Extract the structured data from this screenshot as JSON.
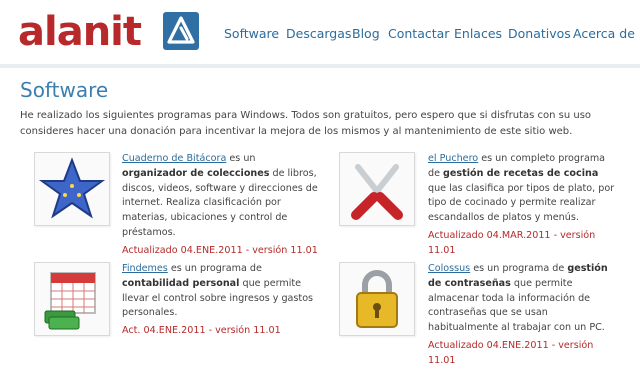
{
  "header": {
    "logo_text": "alanit",
    "nav": [
      "Software",
      "Descargas",
      "Blog",
      "Contactar",
      "Enlaces",
      "Donativos",
      "Acerca de"
    ]
  },
  "page": {
    "title": "Software",
    "intro": "He realizado los siguientes programas para Windows. Todos son gratuitos, pero espero que si disfrutas con su uso consideres hacer una donación para incentivar la mejora de los mismos y al mantenimiento de este sitio web."
  },
  "programs": [
    {
      "icon": "star-icon",
      "name": "Cuaderno de Bitácora",
      "pre": " es un ",
      "bold": "organizador de colecciones",
      "post": " de libros, discos, videos, software y direcciones de internet. Realiza clasificación por materias, ubicaciones y control de préstamos.",
      "updated": "Actualizado 04.ENE.2011 - versión 11.01"
    },
    {
      "icon": "fork-spoon-icon",
      "name": "el Puchero",
      "pre": " es un completo programa de ",
      "bold": "gestión de recetas de cocina",
      "post": " que las clasifica por tipos de plato, por tipo de cocinado y permite realizar escandallos de platos y menús.",
      "updated": "Actualizado 04.MAR.2011 - versión 11.01"
    },
    {
      "icon": "calendar-money-icon",
      "name": "Findemes",
      "pre": " es un programa de ",
      "bold": "contabilidad personal",
      "post": " que permite llevar el control sobre ingresos y gastos personales.",
      "updated": "Act. 04.ENE.2011 - versión 11.01"
    },
    {
      "icon": "padlock-icon",
      "name": "Colossus",
      "pre": " es un programa de ",
      "bold": "gestión de contraseñas",
      "post": " que permite almacenar toda la información de contraseñas que se usan habitualmente al trabajar con un PC.",
      "updated": "Actualizado 04.ENE.2011 - versión 11.01"
    }
  ],
  "colors": {
    "brand": "#b8292c",
    "link": "#2c6c9c",
    "title": "#3b7fb0",
    "updated": "#b32a2a"
  }
}
